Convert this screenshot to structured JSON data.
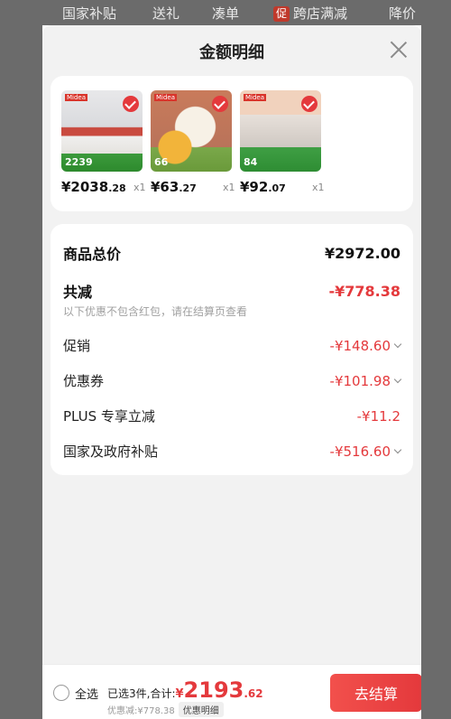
{
  "topbar": {
    "tabs": [
      "国家补贴",
      "送礼",
      "凑单",
      "跨店满减",
      "降价"
    ],
    "promo_badge": "促"
  },
  "sheet": {
    "title": "金额明细"
  },
  "products": [
    {
      "price_int": "¥2038",
      "price_dec": ".28",
      "qty": "x1",
      "thumb_tag": "2239",
      "thumb_brand": "Midea"
    },
    {
      "price_int": "¥63",
      "price_dec": ".27",
      "qty": "x1",
      "thumb_tag": "66",
      "thumb_brand": "Midea"
    },
    {
      "price_int": "¥92",
      "price_dec": ".07",
      "qty": "x1",
      "thumb_tag": "84",
      "thumb_brand": "Midea"
    }
  ],
  "summary": {
    "total_label": "商品总价",
    "total_value": "¥2972.00",
    "reduce_label": "共减",
    "reduce_value": "-¥778.38",
    "note": "以下优惠不包含红包，请在结算页查看",
    "items": [
      {
        "label": "促销",
        "value": "-¥148.60",
        "expandable": true
      },
      {
        "label": "优惠券",
        "value": "-¥101.98",
        "expandable": true
      },
      {
        "label": "PLUS 专享立减",
        "value": "-¥11.2",
        "expandable": false
      },
      {
        "label": "国家及政府补贴",
        "value": "-¥516.60",
        "expandable": true
      }
    ]
  },
  "bottom": {
    "select_all": "全选",
    "selected_prefix": "已选3件,合计:",
    "amount_currency": "¥",
    "amount_int": "2193",
    "amount_dec": ".62",
    "discount_text": "优惠减:¥778.38",
    "discount_button": "优惠明细",
    "checkout": "去结算"
  },
  "colors": {
    "accent": "#e4393c",
    "overlay": "#6b6b6b",
    "sheet_bg": "#f2f2f2"
  }
}
